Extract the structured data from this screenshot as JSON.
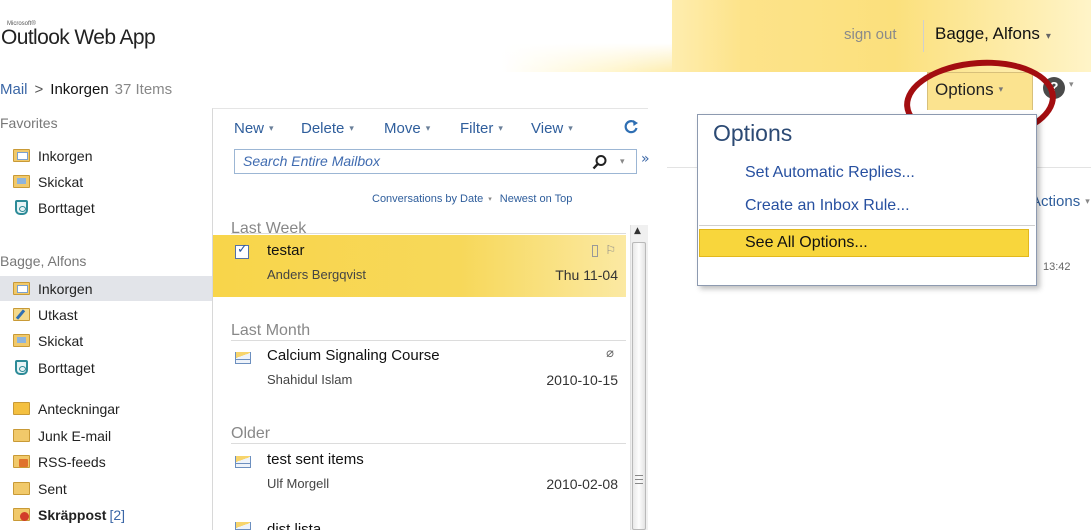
{
  "header": {
    "ms_text": "Microsoft®",
    "app_title": "Outlook Web App",
    "sign_out": "sign out",
    "user_name": "Bagge, Alfons",
    "options_label": "Options",
    "help_glyph": "?"
  },
  "breadcrumb": {
    "root": "Mail",
    "separator": ">",
    "current": "Inkorgen",
    "count": "37 Items"
  },
  "nav": {
    "favorites_label": "Favorites",
    "favorites": [
      {
        "label": "Inkorgen",
        "icon": "inbox-folder-icon"
      },
      {
        "label": "Skickat",
        "icon": "sent-folder-icon"
      },
      {
        "label": "Borttaget",
        "icon": "trash-icon"
      }
    ],
    "mailbox_label": "Bagge, Alfons",
    "folders": [
      {
        "label": "Inkorgen",
        "icon": "inbox-folder-icon"
      },
      {
        "label": "Utkast",
        "icon": "drafts-folder-icon"
      },
      {
        "label": "Skickat",
        "icon": "sent-folder-icon"
      },
      {
        "label": "Borttaget",
        "icon": "trash-icon"
      },
      {
        "label": "Anteckningar",
        "icon": "notes-folder-icon"
      },
      {
        "label": "Junk E-mail",
        "icon": "folder-icon"
      },
      {
        "label": "RSS-feeds",
        "icon": "rss-folder-icon"
      },
      {
        "label": "Sent",
        "icon": "folder-icon"
      },
      {
        "label": "Skräppost",
        "count": "[2]",
        "icon": "junk-folder-icon"
      }
    ]
  },
  "toolbar": {
    "new": "New",
    "delete": "Delete",
    "move": "Move",
    "filter": "Filter",
    "view": "View"
  },
  "search": {
    "placeholder": "Search Entire Mailbox"
  },
  "sort": {
    "by": "Conversations by Date",
    "order": "Newest on Top"
  },
  "groups": {
    "last_week": "Last Week",
    "last_month": "Last Month",
    "older": "Older"
  },
  "messages": [
    {
      "subject": "testar",
      "sender": "Anders Bergqvist",
      "date": "Thu 11-04"
    },
    {
      "subject": "Calcium Signaling Course",
      "sender": "Shahidul Islam",
      "date": "2010-10-15"
    },
    {
      "subject": "test sent items",
      "sender": "Ulf Morgell",
      "date": "2010-02-08"
    },
    {
      "subject": "dist.lista",
      "sender": "",
      "date": ""
    }
  ],
  "reading": {
    "actions_label": "Actions",
    "time": "13:42"
  },
  "options_menu": {
    "title": "Options",
    "auto_replies": "Set Automatic Replies...",
    "inbox_rule": "Create an Inbox Rule...",
    "see_all": "See All Options..."
  },
  "colors": {
    "accent_yellow": "#f8d63c",
    "link_blue": "#2f5e9c",
    "annotation_red": "#a30d10"
  }
}
